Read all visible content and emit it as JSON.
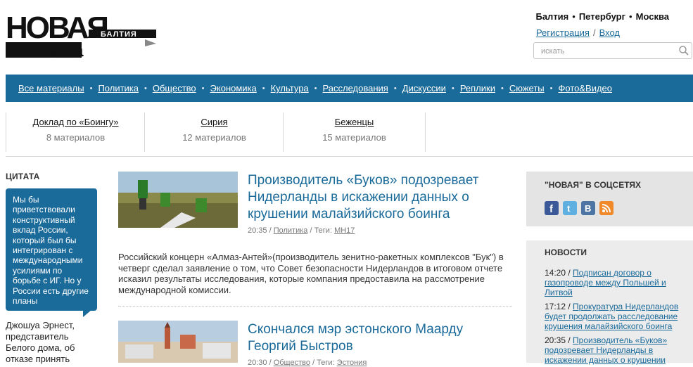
{
  "logo": {
    "line1": "НОВАЯ",
    "line2": "газета",
    "badge": "БАЛТИЯ"
  },
  "header": {
    "cities": [
      "Балтия",
      "Петербург",
      "Москва"
    ],
    "register": "Регистрация",
    "login": "Вход",
    "search_placeholder": "искать"
  },
  "nav": [
    "Все материалы",
    "Политика",
    "Общество",
    "Экономика",
    "Культура",
    "Расследования",
    "Дискуссии",
    "Реплики",
    "Сюжеты",
    "Фото&Видео"
  ],
  "topics": [
    {
      "title": "Доклад по «Боингу»",
      "count": "8 материалов"
    },
    {
      "title": "Сирия",
      "count": "12 материалов"
    },
    {
      "title": "Беженцы",
      "count": "15 материалов"
    }
  ],
  "quote": {
    "heading": "ЦИТАТА",
    "text": "Мы бы приветствовали конструктивный вклад России, который был бы интегрирован с международными усилиями по борьбе с ИГ. Но у России есть другие планы",
    "author": "Джошуа Эрнест, представитель Белого дома, об отказе принять"
  },
  "articles": [
    {
      "title": "Производитель «Буков» подозревает Нидерланды в искажении данных о крушении малайзийского боинга",
      "time": "20:35",
      "section": "Политика",
      "tags_label": "Теги:",
      "tag": "МН17",
      "lead": "Российский концерн «Алмаз-Антей»(производитель зенитно-ракетных комплексов \"Бук\") в четверг сделал заявление о том, что Совет безопасности Нидерландов в итоговом отчете исказил результаты исследования, которые компания предоставила на рассмотрение международной комиссии."
    },
    {
      "title": "Скончался мэр эстонского Маарду Георгий Быстров",
      "time": "20:30",
      "section": "Общество",
      "tags_label": "Теги:",
      "tag": "Эстония"
    }
  ],
  "sidebar": {
    "social_heading": "\"НОВАЯ\" В СОЦСЕТЯХ",
    "social_icons": [
      "facebook-icon",
      "twitter-icon",
      "vkontakte-icon",
      "rss-icon"
    ],
    "news_heading": "НОВОСТИ",
    "news": [
      {
        "time": "14:20",
        "text": "Подписан договор о газопроводе между Польшей и Литвой"
      },
      {
        "time": "17:12",
        "text": "Прокуратура Нидерландов будет продолжать расследование крушения малайзийского боинга"
      },
      {
        "time": "20:35",
        "text": "Производитель «Буков» подозревает Нидерланды в искажении данных о крушении"
      }
    ]
  },
  "colors": {
    "brand_blue": "#1a6a9a"
  }
}
